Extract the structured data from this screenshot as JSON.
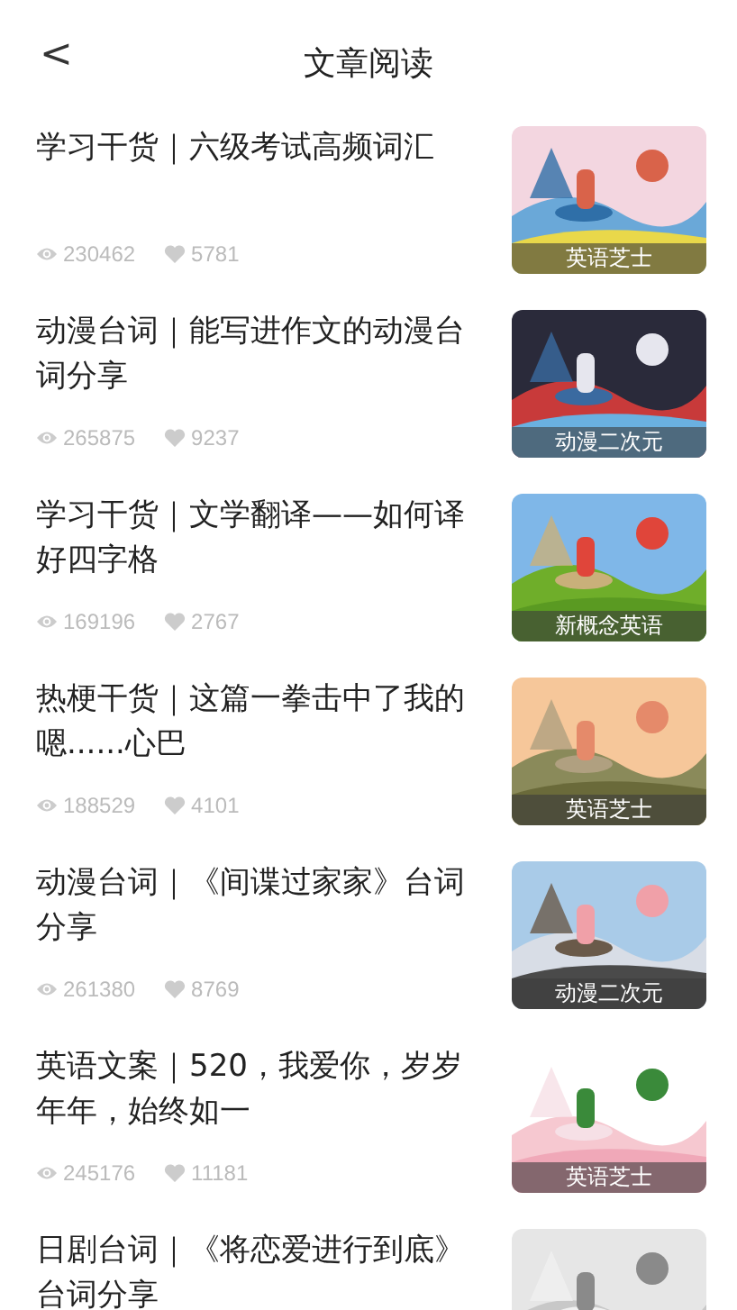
{
  "header": {
    "back": "<",
    "title": "文章阅读"
  },
  "articles": [
    {
      "title": "学习干货｜六级考试高频词汇",
      "views": "230462",
      "likes": "5781",
      "tag": "英语芝士"
    },
    {
      "title": "动漫台词｜能写进作文的动漫台词分享",
      "views": "265875",
      "likes": "9237",
      "tag": "动漫二次元"
    },
    {
      "title": "学习干货｜文学翻译——如何译好四字格",
      "views": "169196",
      "likes": "2767",
      "tag": "新概念英语"
    },
    {
      "title": "热梗干货｜这篇一拳击中了我的嗯......心巴",
      "views": "188529",
      "likes": "4101",
      "tag": "英语芝士"
    },
    {
      "title": "动漫台词｜《间谍过家家》台词分享",
      "views": "261380",
      "likes": "8769",
      "tag": "动漫二次元"
    },
    {
      "title": "英语文案｜520，我爱你，岁岁年年，始终如一",
      "views": "245176",
      "likes": "11181",
      "tag": "英语芝士"
    },
    {
      "title": "日剧台词｜《将恋爱进行到底》台词分享"
    }
  ]
}
